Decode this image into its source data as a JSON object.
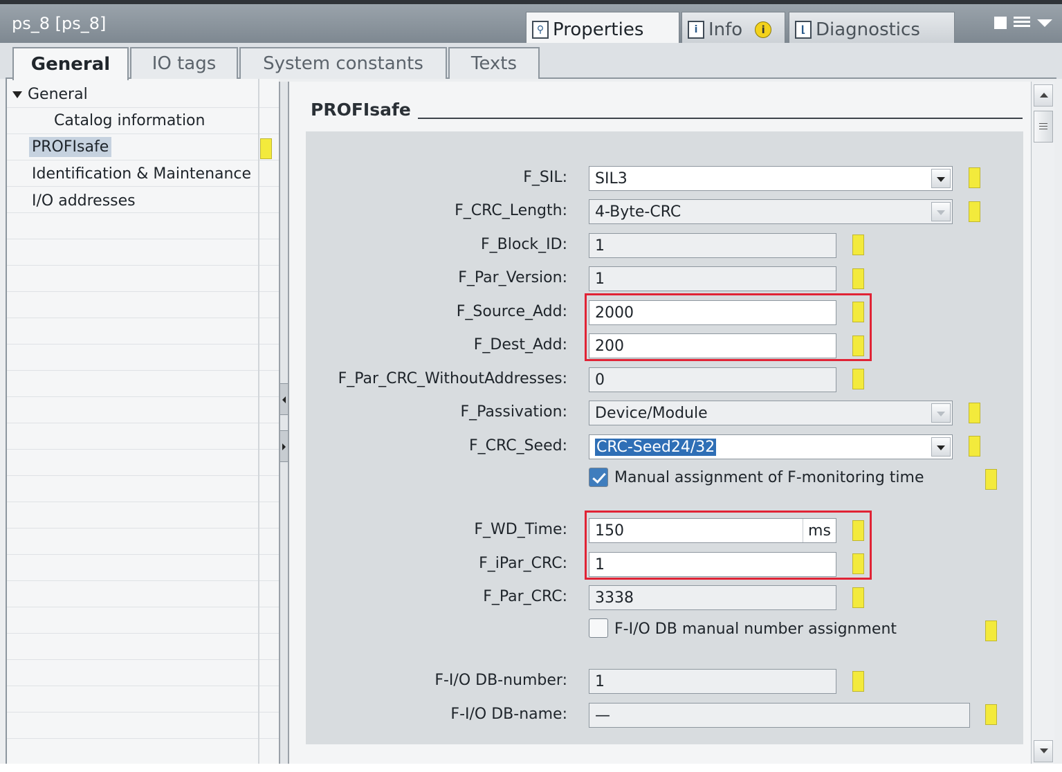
{
  "window": {
    "title": "ps_8 [ps_8]"
  },
  "panel_tabs": [
    {
      "label": "Properties",
      "icon": "properties-icon"
    },
    {
      "label": "Info",
      "icon": "info-icon",
      "badge_icon": "info-badge-icon"
    },
    {
      "label": "Diagnostics",
      "icon": "diagnostics-icon"
    }
  ],
  "sub_tabs": [
    "General",
    "IO tags",
    "System constants",
    "Texts"
  ],
  "nav": [
    {
      "label": "General",
      "expanded": true
    },
    {
      "label": "Catalog information"
    },
    {
      "label": "PROFIsafe",
      "selected": true
    },
    {
      "label": "Identification & Maintenance"
    },
    {
      "label": "I/O addresses"
    }
  ],
  "section": {
    "title": "PROFIsafe"
  },
  "fields": {
    "f_sil": {
      "label": "F_SIL:",
      "value": "SIL3"
    },
    "f_crc_length": {
      "label": "F_CRC_Length:",
      "value": "4-Byte-CRC"
    },
    "f_block_id": {
      "label": "F_Block_ID:",
      "value": "1"
    },
    "f_par_version": {
      "label": "F_Par_Version:",
      "value": "1"
    },
    "f_source_add": {
      "label": "F_Source_Add:",
      "value": "2000"
    },
    "f_dest_add": {
      "label": "F_Dest_Add:",
      "value": "200"
    },
    "f_par_crc_without": {
      "label": "F_Par_CRC_WithoutAddresses:",
      "value": "0"
    },
    "f_passivation": {
      "label": "F_Passivation:",
      "value": "Device/Module"
    },
    "f_crc_seed": {
      "label": "F_CRC_Seed:",
      "value": "CRC-Seed24/32"
    },
    "manual_monitoring": {
      "label": "Manual assignment of F-monitoring time",
      "checked": true
    },
    "f_wd_time": {
      "label": "F_WD_Time:",
      "value": "150",
      "unit": "ms"
    },
    "f_ipar_crc": {
      "label": "F_iPar_CRC:",
      "value": "1"
    },
    "f_par_crc": {
      "label": "F_Par_CRC:",
      "value": "3338"
    },
    "fio_db_manual": {
      "label": "F-I/O DB manual number assignment",
      "checked": false
    },
    "fio_db_number": {
      "label": "F-I/O DB-number:",
      "value": "1"
    },
    "fio_db_name": {
      "label": "F-I/O DB-name:",
      "value": "—"
    }
  },
  "colors": {
    "highlight": "#e02335",
    "marker": "#f3ea3c",
    "selection": "#2f6fb6"
  }
}
